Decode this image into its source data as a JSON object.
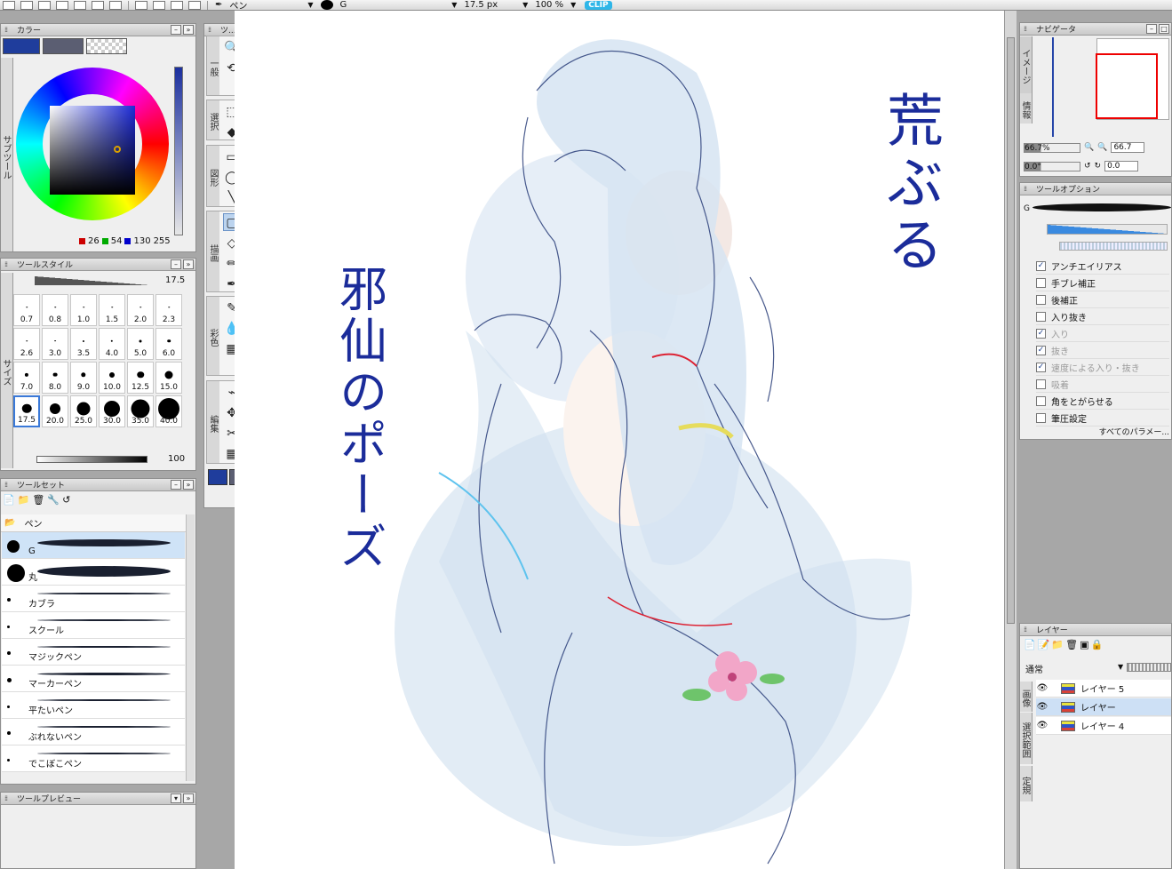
{
  "toolbar": {
    "tool_name": "ペン",
    "brush_name": "G",
    "brush_size": "17.5 px",
    "zoom": "100 %",
    "logo": "CLIP"
  },
  "color_panel": {
    "title": "カラー",
    "main_color": "#1f3d9c",
    "sub_color": "#5b5e72",
    "r": "26",
    "g": "54",
    "b": "130",
    "b_max": "255",
    "tab_label": "サブツール"
  },
  "tool_style": {
    "title": "ツールスタイル",
    "size_value": "17.5",
    "opacity_value": "100",
    "brush_sizes": [
      "0.7",
      "0.8",
      "1.0",
      "1.5",
      "2.0",
      "2.3",
      "2.6",
      "3.0",
      "3.5",
      "4.0",
      "5.0",
      "6.0",
      "7.0",
      "8.0",
      "9.0",
      "10.0",
      "12.5",
      "15.0",
      "17.5",
      "20.0",
      "25.0",
      "30.0",
      "35.0",
      "40.0"
    ],
    "selected": "17.5",
    "side_tab": "サイズ"
  },
  "tool_set": {
    "title": "ツールセット",
    "group": "ペン",
    "items": [
      "G",
      "丸",
      "カブラ",
      "スクール",
      "マジックペン",
      "マーカーペン",
      "平たいペン",
      "ぶれないペン",
      "でこぼこペン"
    ]
  },
  "tool_preview": {
    "title": "ツールプレビュー"
  },
  "tools": {
    "title": "ツ...",
    "groups": [
      "一般",
      "選択",
      "図形",
      "描画",
      "彩色",
      "編集"
    ]
  },
  "canvas": {
    "text_right": "荒ぶる",
    "text_left": "邪仙のポーズ"
  },
  "navigator": {
    "title": "ナビゲータ",
    "tab_image": "イメージ",
    "tab_info": "情報",
    "zoom_value": "66.7%",
    "zoom_field": "66.7",
    "rotate_value": "0.0°",
    "rotate_field": "0.0"
  },
  "tool_options": {
    "title": "ツールオプション",
    "brush_name": "G",
    "options": [
      {
        "label": "アンチエイリアス",
        "checked": true,
        "dim": false
      },
      {
        "label": "手ブレ補正",
        "checked": false,
        "dim": false
      },
      {
        "label": "後補正",
        "checked": false,
        "dim": false
      },
      {
        "label": "入り抜き",
        "checked": false,
        "dim": false
      },
      {
        "label": "入り",
        "checked": true,
        "dim": true
      },
      {
        "label": "抜き",
        "checked": true,
        "dim": true
      },
      {
        "label": "速度による入り・抜き",
        "checked": true,
        "dim": true
      },
      {
        "label": "吸着",
        "checked": false,
        "dim": true
      },
      {
        "label": "角をとがらせる",
        "checked": false,
        "dim": false
      },
      {
        "label": "筆圧設定",
        "checked": false,
        "dim": false
      }
    ],
    "all_params": "すべてのパラメー..."
  },
  "layers": {
    "title": "レイヤー",
    "blend_mode": "通常",
    "tabs": [
      "画像",
      "選択範囲",
      "定規"
    ],
    "items": [
      {
        "name": "レイヤー 5",
        "selected": false
      },
      {
        "name": "レイヤー",
        "selected": true
      },
      {
        "name": "レイヤー 4",
        "selected": false
      }
    ]
  }
}
